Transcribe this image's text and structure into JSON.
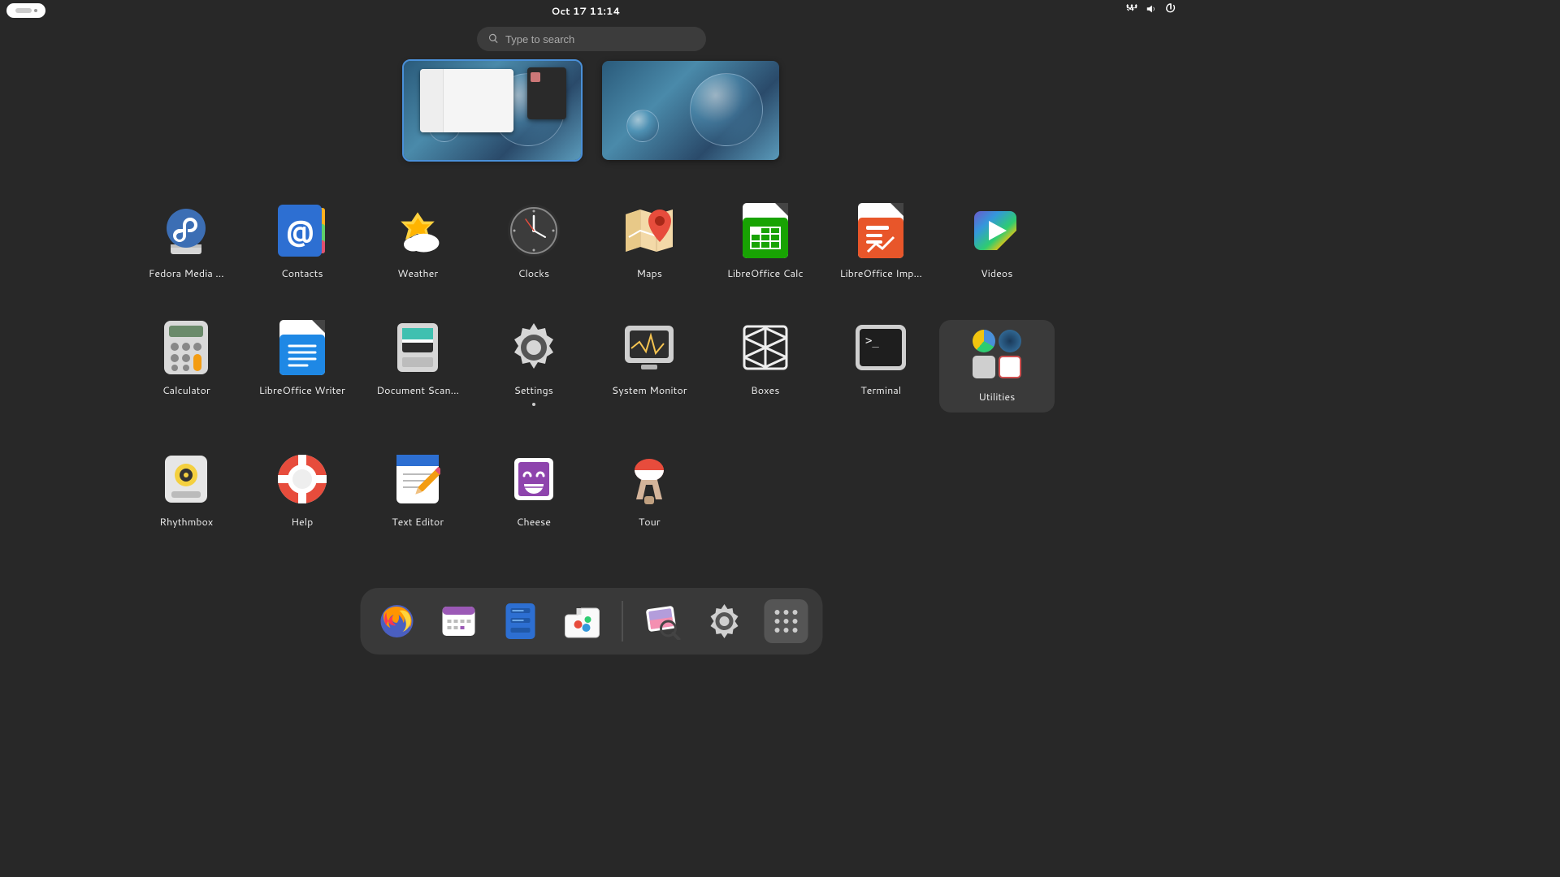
{
  "topbar": {
    "datetime": "Oct 17  11:14"
  },
  "search": {
    "placeholder": "Type to search"
  },
  "apps": [
    {
      "label": "Fedora Media …"
    },
    {
      "label": "Contacts"
    },
    {
      "label": "Weather"
    },
    {
      "label": "Clocks"
    },
    {
      "label": "Maps"
    },
    {
      "label": "LibreOffice Calc"
    },
    {
      "label": "LibreOffice Imp…"
    },
    {
      "label": "Videos"
    },
    {
      "label": "Calculator"
    },
    {
      "label": "LibreOffice Writer"
    },
    {
      "label": "Document Scan…"
    },
    {
      "label": "Settings"
    },
    {
      "label": "System Monitor"
    },
    {
      "label": "Boxes"
    },
    {
      "label": "Terminal"
    },
    {
      "label": "Utilities"
    },
    {
      "label": "Rhythmbox"
    },
    {
      "label": "Help"
    },
    {
      "label": "Text Editor"
    },
    {
      "label": "Cheese"
    },
    {
      "label": "Tour"
    }
  ]
}
